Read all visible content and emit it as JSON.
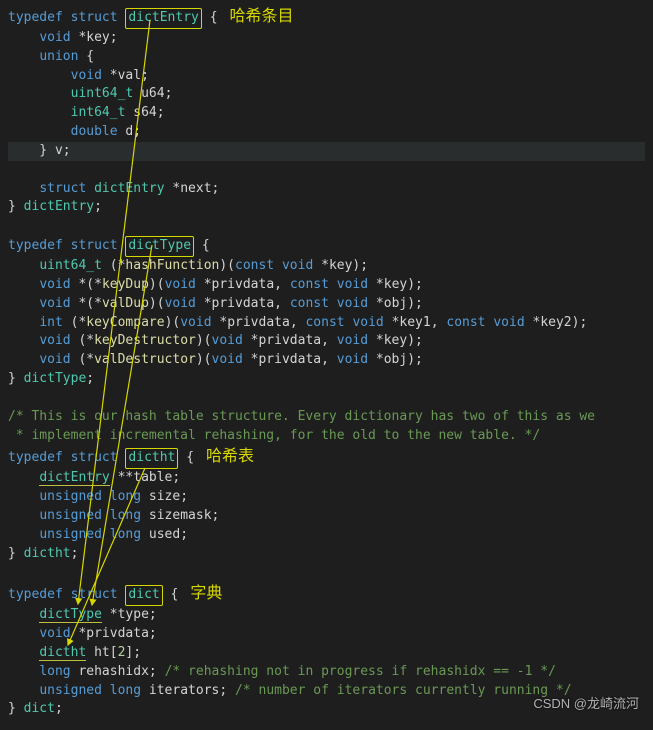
{
  "code": {
    "l1_typedef": "typedef",
    "l1_struct": "struct",
    "l1_name": "dictEntry",
    "l1_brace": " {",
    "l1_anno": "哈希条目",
    "l2": "    void *key;",
    "l3": "    union {",
    "l4": "        void *val;",
    "l5": "        uint64_t u64;",
    "l6": "        int64_t s64;",
    "l7": "        double d;",
    "l8": "    } v;",
    "l9": "    struct dictEntry *next;",
    "l10": "} dictEntry;",
    "l12_typedef": "typedef",
    "l12_struct": "struct",
    "l12_name": "dictType",
    "l12_brace": " {",
    "l13": "    uint64_t (*hashFunction)(const void *key);",
    "l14": "    void *(*keyDup)(void *privdata, const void *key);",
    "l15": "    void *(*valDup)(void *privdata, const void *obj);",
    "l16": "    int (*keyCompare)(void *privdata, const void *key1, const void *key2);",
    "l17": "    void (*keyDestructor)(void *privdata, void *key);",
    "l18": "    void (*valDestructor)(void *privdata, void *obj);",
    "l19": "} dictType;",
    "l21": "/* This is our hash table structure. Every dictionary has two of this as we",
    "l22": " * implement incremental rehashing, for the old to the new table. */",
    "l23_typedef": "typedef",
    "l23_struct": "struct",
    "l23_name": "dictht",
    "l23_brace": " {",
    "l23_anno": "哈希表",
    "l24": "    dictEntry **table;",
    "l25": "    unsigned long size;",
    "l26": "    unsigned long sizemask;",
    "l27": "    unsigned long used;",
    "l28": "} dictht;",
    "l30_typedef": "typedef",
    "l30_struct": "struct",
    "l30_name": "dict",
    "l30_brace": " {",
    "l30_anno": "字典",
    "l31": "    dictType *type;",
    "l32": "    void *privdata;",
    "l33": "    dictht ht[2];",
    "l34a": "    long rehashidx; ",
    "l34c": "/* rehashing not in progress if rehashidx == -1 */",
    "l35a": "    unsigned long iterators; ",
    "l35c": "/* number of iterators currently running */",
    "l36": "} dict;"
  },
  "watermark": "CSDN @龙崎流河"
}
